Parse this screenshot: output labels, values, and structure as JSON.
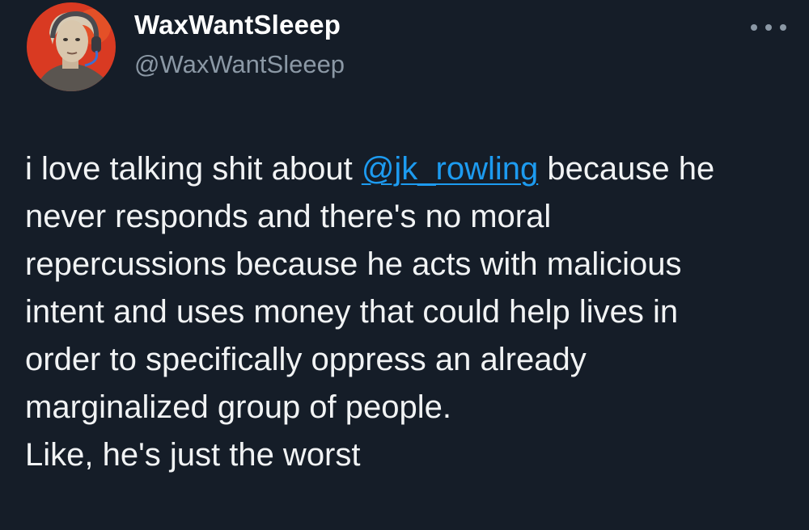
{
  "tweet": {
    "author": {
      "display_name": "WaxWantSleeep",
      "handle": "@WaxWantSleeep",
      "avatar_icon": "avatar-icon"
    },
    "more_icon": "ellipsis-icon",
    "text": {
      "line1_before": "i love talking shit about ",
      "mention": "@jk_rowling",
      "line1_after": " because he",
      "line2": "never responds and there's no moral",
      "line3": "repercussions because he acts with malicious",
      "line4": "intent and uses money that could help lives in",
      "line5": "order to specifically oppress an already",
      "line6": "marginalized group of people.",
      "line7": "Like, he's just the worst"
    }
  },
  "colors": {
    "background": "#151d28",
    "mention": "#1d9bf0",
    "handle": "#8b98a5",
    "avatar_bg": "#d93a22"
  }
}
